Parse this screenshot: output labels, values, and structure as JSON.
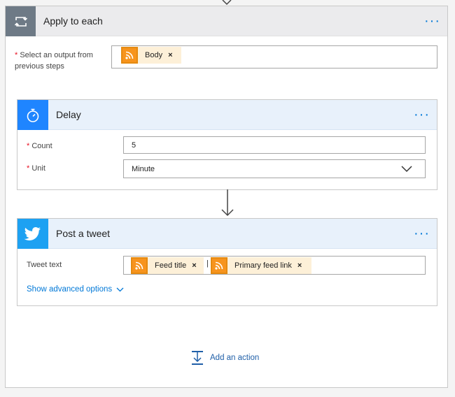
{
  "apply": {
    "title": "Apply to each",
    "more": "···",
    "output_label_line1": "Select an output from",
    "output_label_line2": "previous steps",
    "required_mark": "*",
    "output_token": "Body",
    "remove": "×"
  },
  "delay": {
    "title": "Delay",
    "more": "···",
    "count_label": "Count",
    "count_value": "5",
    "unit_label": "Unit",
    "unit_value": "Minute",
    "required_mark": "*"
  },
  "tweet": {
    "title": "Post a tweet",
    "more": "···",
    "text_label": "Tweet text",
    "tokens": [
      "Feed title",
      "Primary feed link"
    ],
    "separator": "|",
    "remove": "×",
    "advanced": "Show advanced options"
  },
  "actions": {
    "add_action": "Add an action"
  },
  "colors": {
    "accent": "#0078d7",
    "delay_icon_bg": "#1f85ff",
    "twitter_icon_bg": "#1da1f2",
    "rss_orange": "#f7941d",
    "apply_icon_bg": "#6e7a86"
  },
  "icons": {
    "apply": "loop-icon",
    "delay": "stopwatch-icon",
    "tweet": "twitter-bird-icon",
    "token": "rss-icon"
  }
}
